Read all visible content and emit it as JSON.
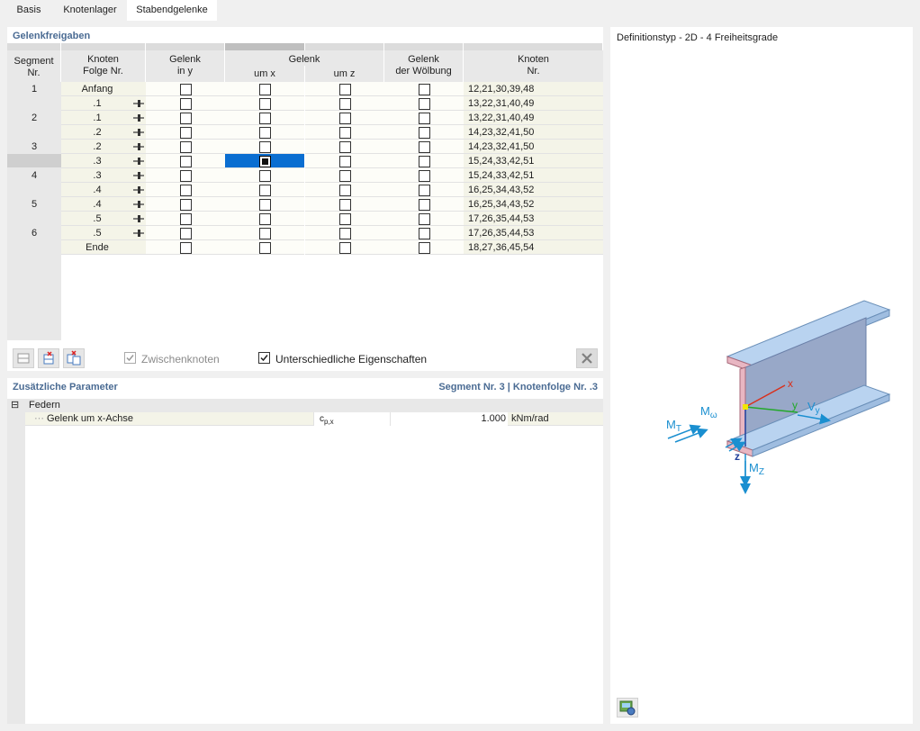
{
  "tabs": [
    {
      "label": "Basis",
      "active": false
    },
    {
      "label": "Knotenlager",
      "active": false
    },
    {
      "label": "Stabendgelenke",
      "active": true
    }
  ],
  "releases": {
    "title": "Gelenkfreigaben",
    "headers": {
      "segment": "Segment\nNr.",
      "node_seq": "Knoten\nFolge Nr.",
      "hinge_y": "Gelenk\nin y",
      "hinge_group": "Gelenk",
      "hinge_x": "um x",
      "hinge_z": "um z",
      "warping": "Gelenk\nder Wölbung",
      "nodes": "Knoten\nNr."
    },
    "rows": [
      {
        "segment": "1",
        "seq": "Anfang",
        "icon": false,
        "nodes": "12,21,30,39,48"
      },
      {
        "segment": "",
        "seq": ".1",
        "icon": true,
        "nodes": "13,22,31,40,49"
      },
      {
        "segment": "2",
        "seq": ".1",
        "icon": true,
        "nodes": "13,22,31,40,49"
      },
      {
        "segment": "",
        "seq": ".2",
        "icon": true,
        "nodes": "14,23,32,41,50"
      },
      {
        "segment": "3",
        "seq": ".2",
        "icon": true,
        "nodes": "14,23,32,41,50"
      },
      {
        "segment": "",
        "seq": ".3",
        "icon": true,
        "nodes": "15,24,33,42,51",
        "selected": true
      },
      {
        "segment": "4",
        "seq": ".3",
        "icon": true,
        "nodes": "15,24,33,42,51"
      },
      {
        "segment": "",
        "seq": ".4",
        "icon": true,
        "nodes": "16,25,34,43,52"
      },
      {
        "segment": "5",
        "seq": ".4",
        "icon": true,
        "nodes": "16,25,34,43,52"
      },
      {
        "segment": "",
        "seq": ".5",
        "icon": true,
        "nodes": "17,26,35,44,53"
      },
      {
        "segment": "6",
        "seq": ".5",
        "icon": true,
        "nodes": "17,26,35,44,53"
      },
      {
        "segment": "",
        "seq": "Ende",
        "icon": false,
        "nodes": "18,27,36,45,54"
      }
    ],
    "checks": {
      "intermediate_nodes": "Zwischenknoten",
      "different_properties": "Unterschiedliche Eigenschaften"
    }
  },
  "params": {
    "title": "Zusätzliche Parameter",
    "context": "Segment Nr. 3 | Knotenfolge Nr. .3",
    "group": "Federn",
    "collapse_symbol": "⊟",
    "item_label": "Gelenk um x-Achse",
    "symbol": "cp,x",
    "value": "1.000",
    "unit": "kNm/rad"
  },
  "preview": {
    "title": "Definitionstyp - 2D - 4 Freiheitsgrade",
    "labels": {
      "x": "x",
      "y": "y",
      "z": "z",
      "mt": "MT",
      "mw": "Mω",
      "vy": "Vy",
      "mz": "MZ"
    }
  },
  "colors": {
    "accent": "#0a6ed1",
    "section_title": "#4a6b93",
    "arrow": "#1a8fd0",
    "axis_x": "#d9301c",
    "axis_y": "#23a82a",
    "axis_z": "#1f3f9a"
  }
}
